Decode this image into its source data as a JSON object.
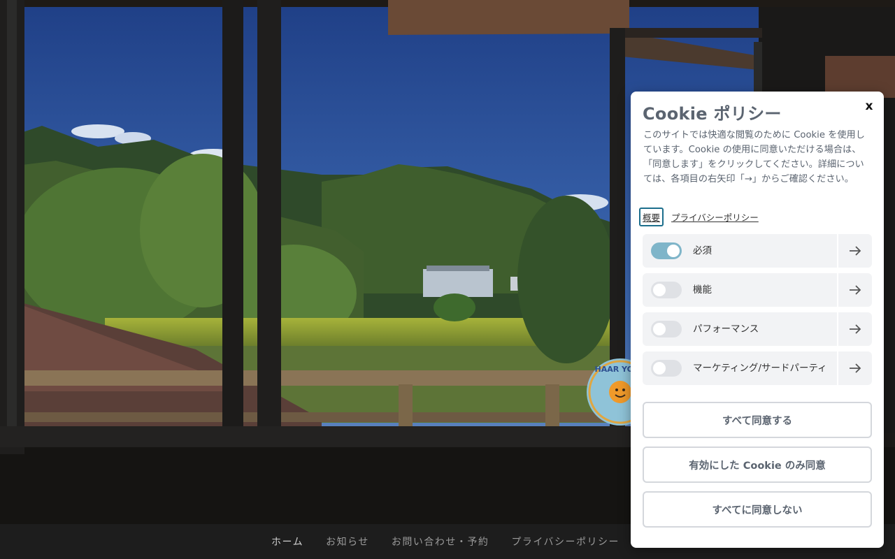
{
  "footer": {
    "links": [
      {
        "label": "ホーム"
      },
      {
        "label": "お知らせ"
      },
      {
        "label": "お問い合わせ・予約"
      },
      {
        "label": "プライバシーポリシー"
      }
    ]
  },
  "badge": {
    "text": "HAAR YOGA"
  },
  "cookie": {
    "title": "Cookie ポリシー",
    "close_label": "x",
    "description": "このサイトでは快適な閲覧のために Cookie を使用しています。Cookie の使用に同意いただける場合は、「同意します」をクリックしてください。詳細については、各項目の右矢印「→」からご確認ください。",
    "tabs": [
      {
        "label": "概要",
        "selected": true
      },
      {
        "label": "プライバシーポリシー",
        "selected": false
      }
    ],
    "categories": [
      {
        "label": "必須",
        "enabled": true
      },
      {
        "label": "機能",
        "enabled": false
      },
      {
        "label": "パフォーマンス",
        "enabled": false
      },
      {
        "label": "マーケティング/サードパーティ",
        "enabled": false
      }
    ],
    "buttons": {
      "accept_all": "すべて同意する",
      "accept_selected": "有効にした Cookie のみ同意",
      "reject_all": "すべてに同意しない"
    },
    "colors": {
      "title": "#5b6470",
      "toggle_on": "#7fb5c9",
      "toggle_off": "#dfe1e5",
      "row_bg": "#f2f3f5",
      "tab_focus": "#1c6e8c"
    }
  }
}
